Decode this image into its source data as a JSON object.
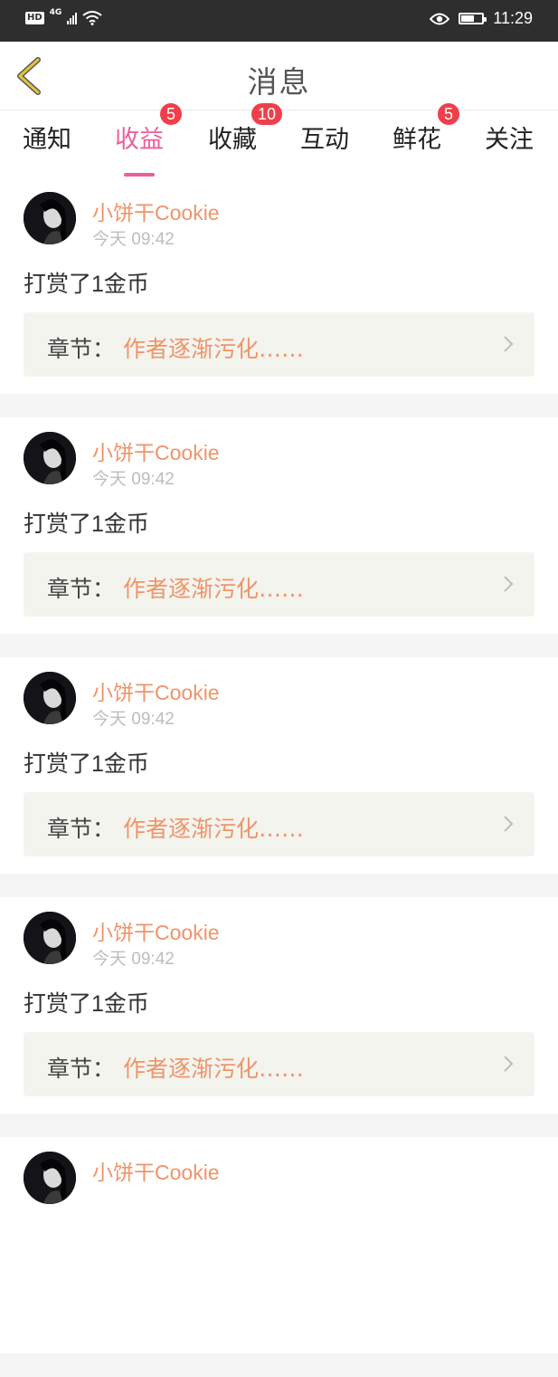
{
  "status_bar": {
    "hd": "HD",
    "network": "4G",
    "time": "11:29"
  },
  "header": {
    "title": "消息"
  },
  "tabs": [
    {
      "label": "通知",
      "badge": null,
      "active": false
    },
    {
      "label": "收益",
      "badge": "5",
      "active": true
    },
    {
      "label": "收藏",
      "badge": "10",
      "active": false
    },
    {
      "label": "互动",
      "badge": null,
      "active": false
    },
    {
      "label": "鲜花",
      "badge": "5",
      "active": false
    },
    {
      "label": "关注",
      "badge": null,
      "active": false
    }
  ],
  "messages": [
    {
      "name": "小饼干Cookie",
      "time": "今天 09:42",
      "text": "打赏了1金币",
      "chapter_label": "章节：",
      "chapter_title": "作者逐渐污化……"
    },
    {
      "name": "小饼干Cookie",
      "time": "今天 09:42",
      "text": "打赏了1金币",
      "chapter_label": "章节：",
      "chapter_title": "作者逐渐污化……"
    },
    {
      "name": "小饼干Cookie",
      "time": "今天 09:42",
      "text": "打赏了1金币",
      "chapter_label": "章节：",
      "chapter_title": "作者逐渐污化……"
    },
    {
      "name": "小饼干Cookie",
      "time": "今天 09:42",
      "text": "打赏了1金币",
      "chapter_label": "章节：",
      "chapter_title": "作者逐渐污化……"
    },
    {
      "name": "小饼干Cookie",
      "time": "",
      "text": "",
      "chapter_label": "",
      "chapter_title": ""
    }
  ],
  "colors": {
    "accent": "#e8609b",
    "name": "#ef9468",
    "badge": "#f03e4a",
    "back_arrow": "#e8c23a"
  }
}
